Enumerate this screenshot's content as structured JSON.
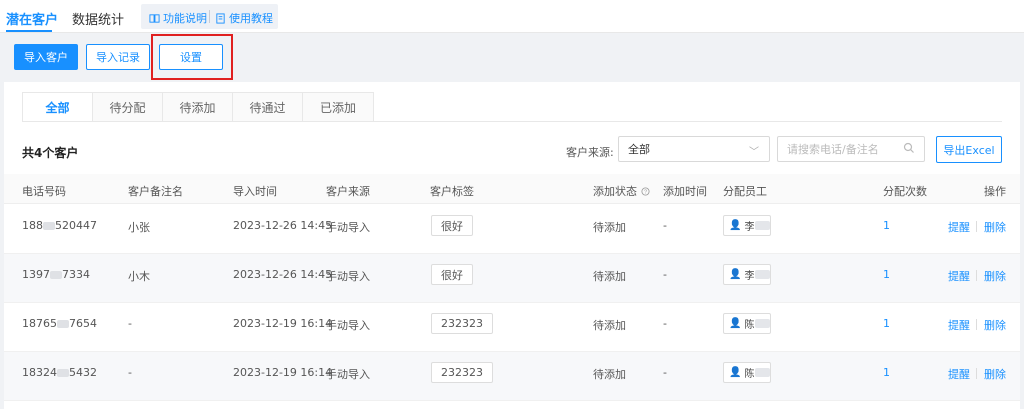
{
  "header": {
    "tabs": [
      {
        "label": "潜在客户",
        "active": true
      },
      {
        "label": "数据统计",
        "active": false
      }
    ],
    "help": [
      {
        "label": "功能说明",
        "icon": "book-icon"
      },
      {
        "label": "使用教程",
        "icon": "document-icon"
      }
    ]
  },
  "toolbar": {
    "import_label": "导入客户",
    "import_record_label": "导入记录",
    "settings_label": "设置"
  },
  "status_tabs": [
    {
      "label": "全部",
      "active": true
    },
    {
      "label": "待分配",
      "active": false
    },
    {
      "label": "待添加",
      "active": false
    },
    {
      "label": "待通过",
      "active": false
    },
    {
      "label": "已添加",
      "active": false
    }
  ],
  "filters": {
    "total_text": "共4个客户",
    "source_label": "客户来源:",
    "source_value": "全部",
    "search_placeholder": "请搜索电话/备注名",
    "export_label": "导出Excel"
  },
  "table": {
    "columns": [
      "电话号码",
      "客户备注名",
      "导入时间",
      "客户来源",
      "客户标签",
      "添加状态",
      "添加时间",
      "分配员工",
      "分配次数",
      "操作"
    ],
    "rows": [
      {
        "phone_start": "188",
        "phone_end": "520447",
        "remark": "小张",
        "time": "2023-12-26 14:45",
        "source": "手动导入",
        "tag": "很好",
        "status": "待添加",
        "added_time": "-",
        "employee": "李",
        "count": "1",
        "remind": "提醒",
        "delete": "删除"
      },
      {
        "phone_start": "1397",
        "phone_end": "7334",
        "remark": "小木",
        "time": "2023-12-26 14:45",
        "source": "手动导入",
        "tag": "很好",
        "status": "待添加",
        "added_time": "-",
        "employee": "李",
        "count": "1",
        "remind": "提醒",
        "delete": "删除"
      },
      {
        "phone_start": "18765",
        "phone_end": "7654",
        "remark": "-",
        "time": "2023-12-19 16:14",
        "source": "手动导入",
        "tag": "232323",
        "status": "待添加",
        "added_time": "-",
        "employee": "陈",
        "count": "1",
        "remind": "提醒",
        "delete": "删除"
      },
      {
        "phone_start": "18324",
        "phone_end": "5432",
        "remark": "-",
        "time": "2023-12-19 16:14",
        "source": "手动导入",
        "tag": "232323",
        "status": "待添加",
        "added_time": "-",
        "employee": "陈",
        "count": "1",
        "remind": "提醒",
        "delete": "删除"
      }
    ]
  },
  "colors": {
    "accent": "#1890ff",
    "highlight": "#e02020"
  }
}
